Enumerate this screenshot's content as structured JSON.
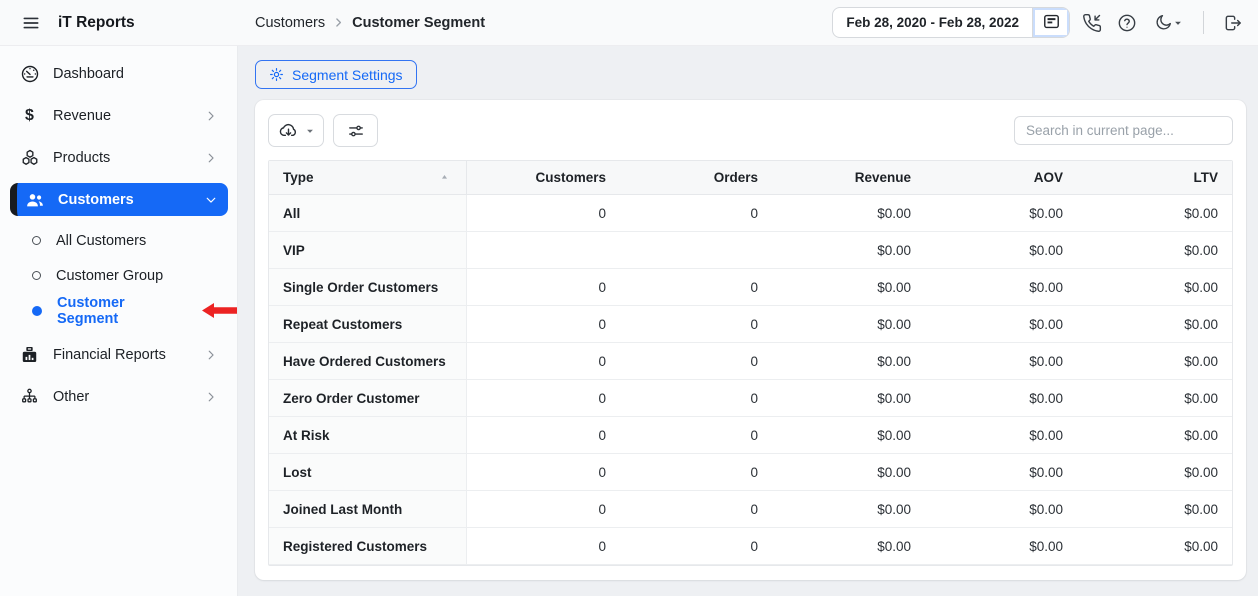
{
  "topbar": {
    "title": "iT Reports",
    "breadcrumb": {
      "parent": "Customers",
      "current": "Customer Segment"
    },
    "date_range": "Feb 28, 2020 - Feb 28, 2022"
  },
  "sidebar": {
    "items": [
      {
        "label": "Dashboard"
      },
      {
        "label": "Revenue"
      },
      {
        "label": "Products"
      },
      {
        "label": "Customers"
      },
      {
        "label": "Financial Reports"
      },
      {
        "label": "Other"
      }
    ],
    "customers_sub": [
      {
        "label": "All Customers"
      },
      {
        "label": "Customer Group"
      },
      {
        "label": "Customer Segment"
      }
    ]
  },
  "main": {
    "segment_settings_label": "Segment Settings",
    "search_placeholder": "Search in current page...",
    "table": {
      "columns": [
        "Type",
        "Customers",
        "Orders",
        "Revenue",
        "AOV",
        "LTV"
      ],
      "rows": [
        [
          "All",
          "0",
          "0",
          "$0.00",
          "$0.00",
          "$0.00"
        ],
        [
          "VIP",
          "",
          "",
          "$0.00",
          "$0.00",
          "$0.00"
        ],
        [
          "Single Order Customers",
          "0",
          "0",
          "$0.00",
          "$0.00",
          "$0.00"
        ],
        [
          "Repeat Customers",
          "0",
          "0",
          "$0.00",
          "$0.00",
          "$0.00"
        ],
        [
          "Have Ordered Customers",
          "0",
          "0",
          "$0.00",
          "$0.00",
          "$0.00"
        ],
        [
          "Zero Order Customer",
          "0",
          "0",
          "$0.00",
          "$0.00",
          "$0.00"
        ],
        [
          "At Risk",
          "0",
          "0",
          "$0.00",
          "$0.00",
          "$0.00"
        ],
        [
          "Lost",
          "0",
          "0",
          "$0.00",
          "$0.00",
          "$0.00"
        ],
        [
          "Joined Last Month",
          "0",
          "0",
          "$0.00",
          "$0.00",
          "$0.00"
        ],
        [
          "Registered Customers",
          "0",
          "0",
          "$0.00",
          "$0.00",
          "$0.00"
        ]
      ]
    }
  },
  "colors": {
    "accent": "#1569f6",
    "annotation_red": "#ec2323"
  }
}
